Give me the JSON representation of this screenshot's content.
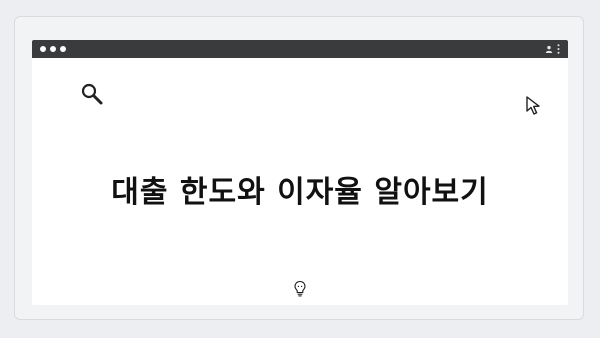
{
  "window": {
    "title": ""
  },
  "main": {
    "headline": "대출 한도와 이자율 알아보기"
  },
  "icons": {
    "search": "search-icon",
    "cursor": "cursor-icon",
    "bulb": "lightbulb-icon",
    "user": "user-icon",
    "menu": "kebab-menu-icon"
  },
  "colors": {
    "titlebar": "#3a3b3d",
    "background": "#f2f3f5",
    "text": "#111111"
  }
}
